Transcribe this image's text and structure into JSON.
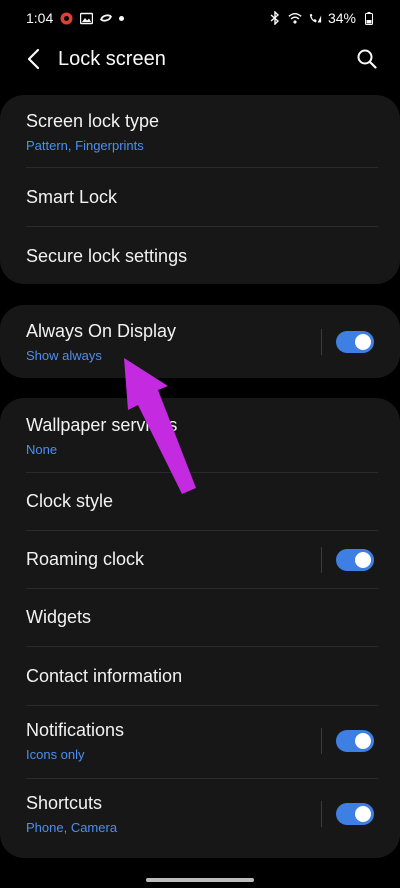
{
  "status_bar": {
    "time": "1:04",
    "battery": "34%"
  },
  "header": {
    "title": "Lock screen"
  },
  "sections": {
    "screen_lock_type": {
      "label": "Screen lock type",
      "sub": "Pattern, Fingerprints"
    },
    "smart_lock": {
      "label": "Smart Lock"
    },
    "secure_lock_settings": {
      "label": "Secure lock settings"
    },
    "always_on_display": {
      "label": "Always On Display",
      "sub": "Show always",
      "toggle": true
    },
    "wallpaper_services": {
      "label": "Wallpaper services",
      "sub": "None"
    },
    "clock_style": {
      "label": "Clock style"
    },
    "roaming_clock": {
      "label": "Roaming clock",
      "toggle": true
    },
    "widgets": {
      "label": "Widgets"
    },
    "contact_information": {
      "label": "Contact information"
    },
    "notifications": {
      "label": "Notifications",
      "sub": "Icons only",
      "toggle": true
    },
    "shortcuts": {
      "label": "Shortcuts",
      "sub": "Phone, Camera",
      "toggle": true
    }
  },
  "colors": {
    "accent": "#3e7fe4",
    "subtext": "#4d8ff0",
    "annotation_arrow": "#c42be0",
    "card": "#171717"
  },
  "icons": [
    "back-arrow-icon",
    "search-icon",
    "bluetooth-icon",
    "wifi-icon",
    "signal-icon",
    "battery-icon",
    "gallery-icon",
    "notification-icon"
  ]
}
